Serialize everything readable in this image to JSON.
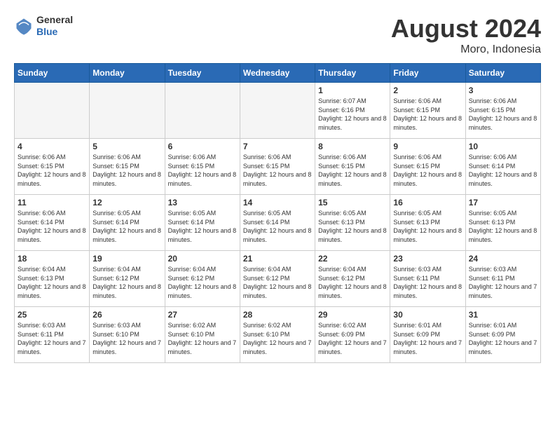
{
  "header": {
    "logo_general": "General",
    "logo_blue": "Blue",
    "month_year": "August 2024",
    "location": "Moro, Indonesia"
  },
  "weekdays": [
    "Sunday",
    "Monday",
    "Tuesday",
    "Wednesday",
    "Thursday",
    "Friday",
    "Saturday"
  ],
  "weeks": [
    [
      {
        "day": "",
        "empty": true
      },
      {
        "day": "",
        "empty": true
      },
      {
        "day": "",
        "empty": true
      },
      {
        "day": "",
        "empty": true
      },
      {
        "day": "1",
        "sunrise": "6:07 AM",
        "sunset": "6:16 PM",
        "daylight": "12 hours and 8 minutes."
      },
      {
        "day": "2",
        "sunrise": "6:06 AM",
        "sunset": "6:15 PM",
        "daylight": "12 hours and 8 minutes."
      },
      {
        "day": "3",
        "sunrise": "6:06 AM",
        "sunset": "6:15 PM",
        "daylight": "12 hours and 8 minutes."
      }
    ],
    [
      {
        "day": "4",
        "sunrise": "6:06 AM",
        "sunset": "6:15 PM",
        "daylight": "12 hours and 8 minutes."
      },
      {
        "day": "5",
        "sunrise": "6:06 AM",
        "sunset": "6:15 PM",
        "daylight": "12 hours and 8 minutes."
      },
      {
        "day": "6",
        "sunrise": "6:06 AM",
        "sunset": "6:15 PM",
        "daylight": "12 hours and 8 minutes."
      },
      {
        "day": "7",
        "sunrise": "6:06 AM",
        "sunset": "6:15 PM",
        "daylight": "12 hours and 8 minutes."
      },
      {
        "day": "8",
        "sunrise": "6:06 AM",
        "sunset": "6:15 PM",
        "daylight": "12 hours and 8 minutes."
      },
      {
        "day": "9",
        "sunrise": "6:06 AM",
        "sunset": "6:15 PM",
        "daylight": "12 hours and 8 minutes."
      },
      {
        "day": "10",
        "sunrise": "6:06 AM",
        "sunset": "6:14 PM",
        "daylight": "12 hours and 8 minutes."
      }
    ],
    [
      {
        "day": "11",
        "sunrise": "6:06 AM",
        "sunset": "6:14 PM",
        "daylight": "12 hours and 8 minutes."
      },
      {
        "day": "12",
        "sunrise": "6:05 AM",
        "sunset": "6:14 PM",
        "daylight": "12 hours and 8 minutes."
      },
      {
        "day": "13",
        "sunrise": "6:05 AM",
        "sunset": "6:14 PM",
        "daylight": "12 hours and 8 minutes."
      },
      {
        "day": "14",
        "sunrise": "6:05 AM",
        "sunset": "6:14 PM",
        "daylight": "12 hours and 8 minutes."
      },
      {
        "day": "15",
        "sunrise": "6:05 AM",
        "sunset": "6:13 PM",
        "daylight": "12 hours and 8 minutes."
      },
      {
        "day": "16",
        "sunrise": "6:05 AM",
        "sunset": "6:13 PM",
        "daylight": "12 hours and 8 minutes."
      },
      {
        "day": "17",
        "sunrise": "6:05 AM",
        "sunset": "6:13 PM",
        "daylight": "12 hours and 8 minutes."
      }
    ],
    [
      {
        "day": "18",
        "sunrise": "6:04 AM",
        "sunset": "6:13 PM",
        "daylight": "12 hours and 8 minutes."
      },
      {
        "day": "19",
        "sunrise": "6:04 AM",
        "sunset": "6:12 PM",
        "daylight": "12 hours and 8 minutes."
      },
      {
        "day": "20",
        "sunrise": "6:04 AM",
        "sunset": "6:12 PM",
        "daylight": "12 hours and 8 minutes."
      },
      {
        "day": "21",
        "sunrise": "6:04 AM",
        "sunset": "6:12 PM",
        "daylight": "12 hours and 8 minutes."
      },
      {
        "day": "22",
        "sunrise": "6:04 AM",
        "sunset": "6:12 PM",
        "daylight": "12 hours and 8 minutes."
      },
      {
        "day": "23",
        "sunrise": "6:03 AM",
        "sunset": "6:11 PM",
        "daylight": "12 hours and 8 minutes."
      },
      {
        "day": "24",
        "sunrise": "6:03 AM",
        "sunset": "6:11 PM",
        "daylight": "12 hours and 7 minutes."
      }
    ],
    [
      {
        "day": "25",
        "sunrise": "6:03 AM",
        "sunset": "6:11 PM",
        "daylight": "12 hours and 7 minutes."
      },
      {
        "day": "26",
        "sunrise": "6:03 AM",
        "sunset": "6:10 PM",
        "daylight": "12 hours and 7 minutes."
      },
      {
        "day": "27",
        "sunrise": "6:02 AM",
        "sunset": "6:10 PM",
        "daylight": "12 hours and 7 minutes."
      },
      {
        "day": "28",
        "sunrise": "6:02 AM",
        "sunset": "6:10 PM",
        "daylight": "12 hours and 7 minutes."
      },
      {
        "day": "29",
        "sunrise": "6:02 AM",
        "sunset": "6:09 PM",
        "daylight": "12 hours and 7 minutes."
      },
      {
        "day": "30",
        "sunrise": "6:01 AM",
        "sunset": "6:09 PM",
        "daylight": "12 hours and 7 minutes."
      },
      {
        "day": "31",
        "sunrise": "6:01 AM",
        "sunset": "6:09 PM",
        "daylight": "12 hours and 7 minutes."
      }
    ]
  ]
}
